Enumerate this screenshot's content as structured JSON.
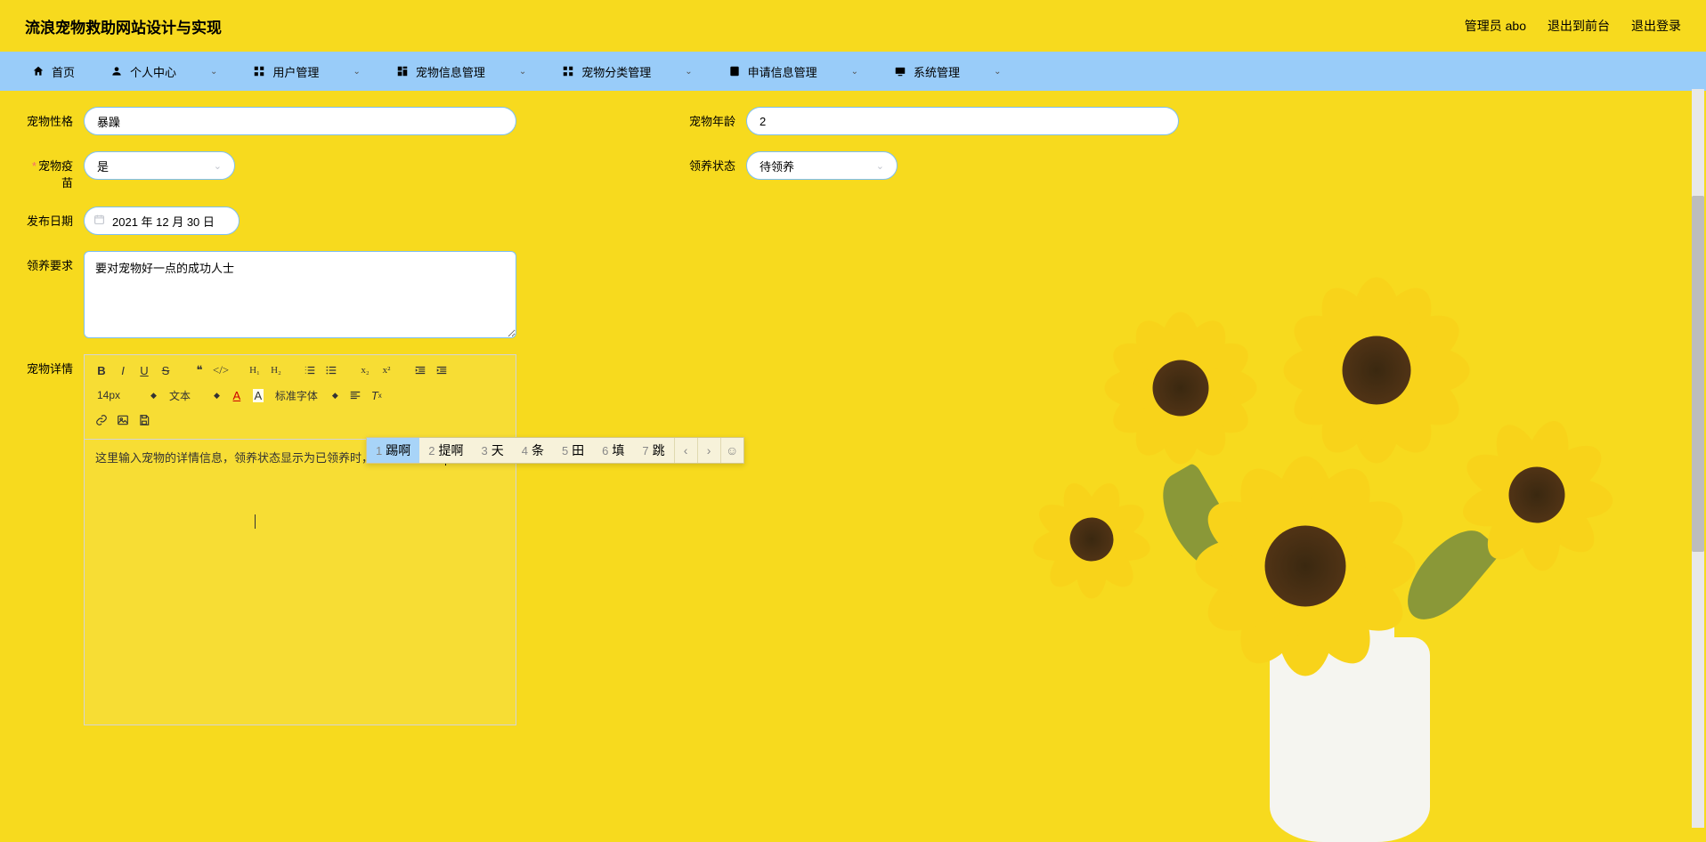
{
  "header": {
    "title": "流浪宠物救助网站设计与实现",
    "user_label": "管理员 abo",
    "logout_front": "退出到前台",
    "logout": "退出登录"
  },
  "nav": {
    "home": "首页",
    "personal": "个人中心",
    "user_mgmt": "用户管理",
    "pet_info": "宠物信息管理",
    "pet_category": "宠物分类管理",
    "apply_info": "申请信息管理",
    "system": "系统管理"
  },
  "form": {
    "personality_label": "宠物性格",
    "personality_value": "暴躁",
    "age_label": "宠物年龄",
    "age_value": "2",
    "vaccine_label": "宠物疫苗",
    "vaccine_value": "是",
    "status_label": "领养状态",
    "status_value": "待领养",
    "pubdate_label": "发布日期",
    "pubdate_value": "2021 年 12 月 30 日",
    "require_label": "领养要求",
    "require_value": "要对宠物好一点的成功人士",
    "detail_label": "宠物详情",
    "detail_content": "这里输入宠物的详情信息，领养状态显示为已领养时，用户是无法ti'a"
  },
  "editor": {
    "fontsize": "14px",
    "format": "文本",
    "fontfamily": "标准字体"
  },
  "ime": {
    "candidates": [
      {
        "n": "1",
        "t": "踢啊"
      },
      {
        "n": "2",
        "t": "提啊"
      },
      {
        "n": "3",
        "t": "天"
      },
      {
        "n": "4",
        "t": "条"
      },
      {
        "n": "5",
        "t": "田"
      },
      {
        "n": "6",
        "t": "填"
      },
      {
        "n": "7",
        "t": "跳"
      }
    ]
  }
}
